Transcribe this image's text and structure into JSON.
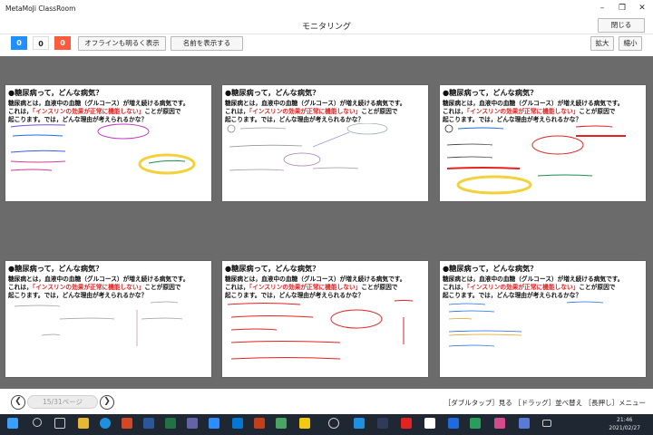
{
  "app": {
    "title": "MetaMoJi ClassRoom",
    "screen_title": "モニタリング"
  },
  "header": {
    "close_label": "閉じる"
  },
  "toolbar": {
    "counters": [
      {
        "value": "0",
        "color": "#1e90ff"
      },
      {
        "value": "0",
        "color": "#ffffff"
      },
      {
        "value": "0",
        "color": "#ff5a3c"
      }
    ],
    "offline_label": "オフラインも明るく表示",
    "show_names_label": "名前を表示する",
    "zoom_in_label": "拡大",
    "zoom_out_label": "縮小"
  },
  "question": {
    "title": "●糖尿病って，どんな病気？",
    "line1": "糖尿病とは，血液中の血糖（グルコース）が増え続ける病気です。",
    "line2_prefix": "これは，",
    "line2_red": "「インスリンの効果が正常に機能しない」",
    "line2_suffix": "ことが原因で",
    "line3": "起こります。では，どんな理由が考えられるかな？"
  },
  "pagination": {
    "page_label": "15/31ページ"
  },
  "help_text": "［ダブルタップ］見る ［ドラッグ］並べ替え ［長押し］メニュー",
  "taskbar": {
    "clock_time": "21:46",
    "clock_date": "2021/02/27",
    "accent": "#1f2733"
  }
}
